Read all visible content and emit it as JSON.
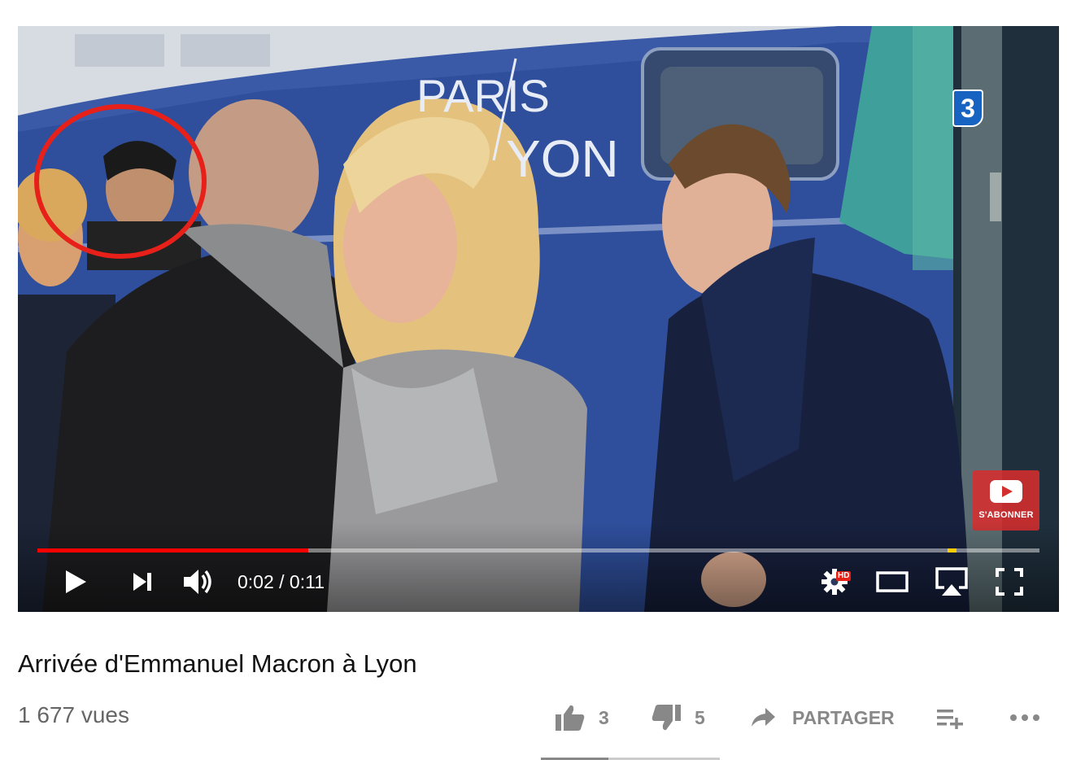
{
  "video": {
    "title": "Arrivée d'Emmanuel Macron à Lyon",
    "views": "1 677 vues",
    "scene_text": "PARIS / LYON",
    "channel_logo": "3"
  },
  "player": {
    "time_display": "0:02 / 0:11",
    "progress_fraction": 0.27,
    "hd_badge": "HD",
    "subscribe_label": "S'ABONNER",
    "icons": [
      "play-icon",
      "next-icon",
      "volume-icon",
      "settings-icon",
      "theater-mode-icon",
      "airplay-icon",
      "fullscreen-icon"
    ]
  },
  "actions": {
    "likes": "3",
    "dislikes": "5",
    "share_label": "PARTAGER",
    "like_fraction": 0.375,
    "icons": [
      "thumbs-up-icon",
      "thumbs-down-icon",
      "share-arrow-icon",
      "add-to-playlist-icon",
      "more-icon"
    ]
  },
  "colors": {
    "progress": "#ff0000",
    "subscribe": "#d32f2f",
    "annotation_circle": "#e8201a"
  }
}
